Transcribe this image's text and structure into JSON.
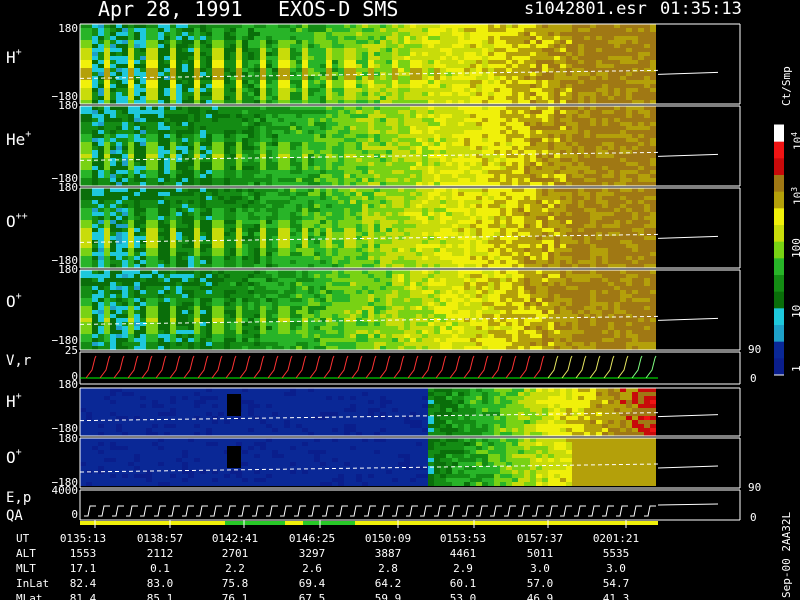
{
  "header": {
    "date": "Apr 28, 1991",
    "instrument": "EXOS-D SMS",
    "file": "s1042801.esr",
    "time": "01:35:13"
  },
  "side_info": "Sep-00  2AA32L",
  "colorbar": {
    "unit_label": "Ct/Smp",
    "tick_labels": [
      "1",
      "10",
      "100",
      "10",
      "3",
      "10",
      "4"
    ],
    "ticks": [
      {
        "label": "1",
        "value": 1
      },
      {
        "label": "10",
        "value": 10
      },
      {
        "label": "100",
        "value": 100
      },
      {
        "label": "10^3",
        "value": 1000
      },
      {
        "label": "10^4",
        "value": 10000
      }
    ],
    "colors": [
      "#0a1e8c",
      "#0a2896",
      "#1ea0c8",
      "#1ec8dc",
      "#0a6e0a",
      "#148c14",
      "#28b428",
      "#78d214",
      "#c8dc0a",
      "#f0f00a",
      "#b4a00a",
      "#a07814",
      "#c80a0a",
      "#f01414",
      "#ffffff"
    ]
  },
  "panel_labels": {
    "hplus": "H",
    "heplus": "He",
    "oplusplus": "O",
    "oplus": "O",
    "vr": "V,r",
    "hplus2": "H",
    "oplus2": "O",
    "ep": "E,p",
    "qa": "QA",
    "sup_plus": "+",
    "sup_plusplus": "++"
  },
  "axis_ticks": {
    "ang_top": "180",
    "ang_bottom": "−180",
    "vr_top": "25",
    "vr_zero": "0",
    "vr_right_top": "90",
    "vr_right_bottom": "0",
    "ep_top": "4000",
    "ep_zero": "0",
    "ep_right_top": "90",
    "ep_right_bottom": "0"
  },
  "footer": {
    "row_labels": [
      "UT",
      "ALT",
      "MLT",
      "InLat",
      "MLat"
    ],
    "columns": [
      {
        "UT": "0135:13",
        "ALT": "1553",
        "MLT": "17.1",
        "InLat": "82.4",
        "MLat": "81.4"
      },
      {
        "UT": "0138:57",
        "ALT": "2112",
        "MLT": "0.1",
        "InLat": "83.0",
        "MLat": "85.1"
      },
      {
        "UT": "0142:41",
        "ALT": "2701",
        "MLT": "2.2",
        "InLat": "75.8",
        "MLat": "76.1"
      },
      {
        "UT": "0146:25",
        "ALT": "3297",
        "MLT": "2.6",
        "InLat": "69.4",
        "MLat": "67.5"
      },
      {
        "UT": "0150:09",
        "ALT": "3887",
        "MLT": "2.8",
        "InLat": "64.2",
        "MLat": "59.9"
      },
      {
        "UT": "0153:53",
        "ALT": "4461",
        "MLT": "2.9",
        "InLat": "60.1",
        "MLat": "53.0"
      },
      {
        "UT": "0157:37",
        "ALT": "5011",
        "MLT": "3.0",
        "InLat": "57.0",
        "MLat": "46.9"
      },
      {
        "UT": "0201:21",
        "ALT": "5535",
        "MLT": "3.0",
        "InLat": "54.7",
        "MLat": "41.3"
      }
    ]
  },
  "chart_data": {
    "type": "heatmap",
    "title": "Apr 28, 1991   EXOS-D SMS",
    "x_ticks": [
      "0135:13",
      "0138:57",
      "0142:41",
      "0146:25",
      "0150:09",
      "0153:53",
      "0157:37",
      "0201:21"
    ],
    "panels": [
      {
        "name": "H+",
        "ylim": [
          -180,
          180
        ]
      },
      {
        "name": "He+",
        "ylim": [
          -180,
          180
        ]
      },
      {
        "name": "O++",
        "ylim": [
          -180,
          180
        ]
      },
      {
        "name": "O+",
        "ylim": [
          -180,
          180
        ]
      },
      {
        "name": "V,r",
        "ylim": [
          0,
          25
        ],
        "right_ylim": [
          0,
          90
        ]
      },
      {
        "name": "H+",
        "ylim": [
          -180,
          180
        ]
      },
      {
        "name": "O+",
        "ylim": [
          -180,
          180
        ]
      },
      {
        "name": "E,p",
        "ylim": [
          0,
          4000
        ],
        "right_ylim": [
          0,
          90
        ]
      },
      {
        "name": "QA"
      }
    ],
    "colorscale": "log",
    "color_range": [
      1,
      10000
    ],
    "grid": false
  }
}
